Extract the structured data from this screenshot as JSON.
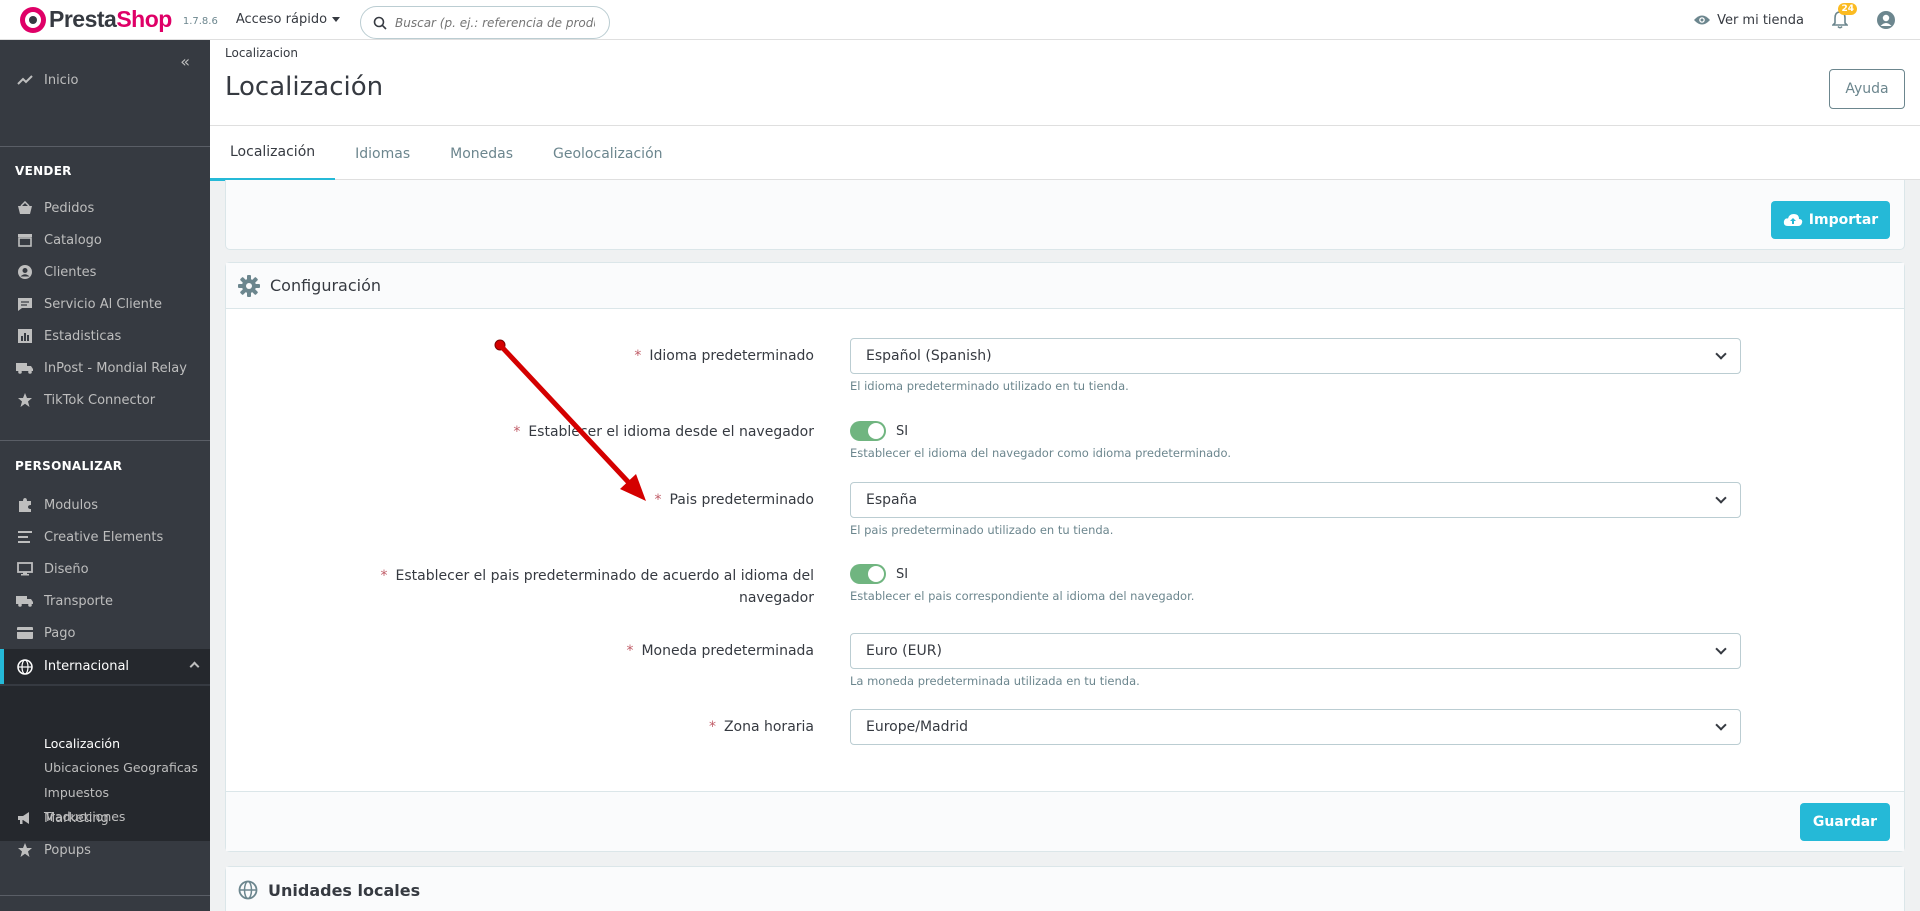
{
  "header": {
    "logo_part1": "Presta",
    "logo_part2": "Shop",
    "version": "1.7.8.6",
    "quick_access": "Acceso rápido",
    "search_placeholder": "Buscar (p. ej.: referencia de producto,",
    "view_shop": "Ver mi tienda",
    "notifications_count": "24"
  },
  "sidebar": {
    "home": "Inicio",
    "section_sell": "VENDER",
    "sell_items": [
      "Pedidos",
      "Catalogo",
      "Clientes",
      "Servicio Al Cliente",
      "Estadisticas",
      "InPost - Mondial Relay",
      "TikTok Connector"
    ],
    "section_customize": "PERSONALIZAR",
    "customize_items": [
      "Modulos",
      "Creative Elements",
      "Diseño",
      "Transporte",
      "Pago",
      "Internacional"
    ],
    "sub_items": [
      "Localización",
      "Ubicaciones Geograficas",
      "Impuestos",
      "Traducciones"
    ],
    "after_items": [
      "Marketing",
      "Popups"
    ]
  },
  "page": {
    "breadcrumb": "Localizacion",
    "title": "Localización",
    "help": "Ayuda",
    "tabs": [
      "Localización",
      "Idiomas",
      "Monedas",
      "Geolocalización"
    ]
  },
  "import": {
    "button": "Importar"
  },
  "config": {
    "title": "Configuración",
    "fields": [
      {
        "label": "Idioma predeterminado",
        "value": "Español (Spanish)",
        "help": "El idioma predeterminado utilizado en tu tienda."
      },
      {
        "label": "Establecer el idioma desde el navegador",
        "value": "SI",
        "help": "Establecer el idioma del navegador como idioma predeterminado."
      },
      {
        "label": "Pais predeterminado",
        "value": "España",
        "help": "El pais predeterminado utilizado en tu tienda."
      },
      {
        "label_line1": "Establecer el pais predeterminado de acuerdo al idioma del",
        "label_line2": "navegador",
        "value": "SI",
        "help": "Establecer el pais correspondiente al idioma del navegador."
      },
      {
        "label": "Moneda predeterminada",
        "value": "Euro (EUR)",
        "help": "La moneda predeterminada utilizada en tu tienda."
      },
      {
        "label": "Zona horaria",
        "value": "Europe/Madrid"
      }
    ],
    "save": "Guardar"
  },
  "units": {
    "title": "Unidades locales"
  },
  "colors": {
    "accent": "#25b9d7",
    "brand": "#df0067",
    "sidebar": "#363a41",
    "toggle_on": "#70b580",
    "required": "#c05c67",
    "annotation_arrow": "#d40000"
  }
}
